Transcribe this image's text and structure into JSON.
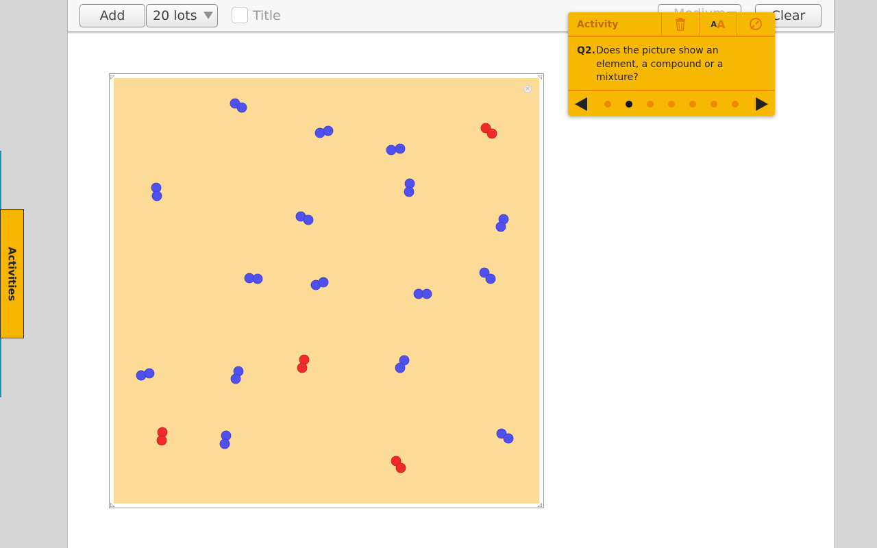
{
  "toolbar": {
    "add_label": "Add",
    "amount_select": "20 lots",
    "title_label": "Title",
    "title_checked": false,
    "medium_select": "Medium",
    "clear_label": "Clear"
  },
  "side_tab": {
    "label": "Activities"
  },
  "activity": {
    "header": "Activity",
    "question_number": "Q2.",
    "question_text": "Does the picture show an element, a compound or a mixture?",
    "current_question": 2,
    "total_questions": 7,
    "icons": [
      "trash-icon",
      "font-size-icon",
      "timer-icon"
    ]
  },
  "simulation": {
    "colors": {
      "blue": "#5050ee",
      "red": "#ee2a2a",
      "background": "#fcdb96"
    },
    "molecules": [
      {
        "color": "blue",
        "atoms": [
          [
            342,
            151
          ],
          [
            352,
            157
          ]
        ]
      },
      {
        "color": "blue",
        "atoms": [
          [
            466,
            194
          ],
          [
            478,
            191
          ]
        ]
      },
      {
        "color": "blue",
        "atoms": [
          [
            570,
            219
          ],
          [
            583,
            217
          ]
        ]
      },
      {
        "color": "red",
        "atoms": [
          [
            708,
            187
          ],
          [
            717,
            195
          ]
        ]
      },
      {
        "color": "blue",
        "atoms": [
          [
            227,
            274
          ],
          [
            228,
            286
          ]
        ]
      },
      {
        "color": "blue",
        "atoms": [
          [
            597,
            268
          ],
          [
            596,
            280
          ]
        ]
      },
      {
        "color": "blue",
        "atoms": [
          [
            438,
            316
          ],
          [
            449,
            321
          ]
        ]
      },
      {
        "color": "blue",
        "atoms": [
          [
            734,
            320
          ],
          [
            730,
            331
          ]
        ]
      },
      {
        "color": "blue",
        "atoms": [
          [
            363,
            406
          ],
          [
            375,
            407
          ]
        ]
      },
      {
        "color": "blue",
        "atoms": [
          [
            460,
            416
          ],
          [
            471,
            412
          ]
        ]
      },
      {
        "color": "blue",
        "atoms": [
          [
            610,
            429
          ],
          [
            622,
            429
          ]
        ]
      },
      {
        "color": "blue",
        "atoms": [
          [
            706,
            398
          ],
          [
            715,
            407
          ]
        ]
      },
      {
        "color": "blue",
        "atoms": [
          [
            205,
            548
          ],
          [
            217,
            545
          ]
        ]
      },
      {
        "color": "blue",
        "atoms": [
          [
            347,
            542
          ],
          [
            343,
            553
          ]
        ]
      },
      {
        "color": "red",
        "atoms": [
          [
            443,
            525
          ],
          [
            440,
            537
          ]
        ]
      },
      {
        "color": "blue",
        "atoms": [
          [
            589,
            526
          ],
          [
            583,
            537
          ]
        ]
      },
      {
        "color": "red",
        "atoms": [
          [
            236,
            631
          ],
          [
            235,
            643
          ]
        ]
      },
      {
        "color": "blue",
        "atoms": [
          [
            329,
            636
          ],
          [
            327,
            648
          ]
        ]
      },
      {
        "color": "blue",
        "atoms": [
          [
            731,
            633
          ],
          [
            741,
            640
          ]
        ]
      },
      {
        "color": "red",
        "atoms": [
          [
            577,
            673
          ],
          [
            584,
            683
          ]
        ]
      }
    ]
  }
}
